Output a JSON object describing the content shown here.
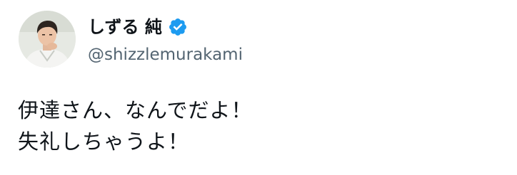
{
  "author": {
    "display_name": "しずる 純",
    "handle": "@shizzlemurakami",
    "verified_icon": "verified-badge-icon",
    "avatar_icon": "profile-photo"
  },
  "tweet": {
    "lines": [
      "伊達さん、なんでだよ！",
      "失礼しちゃうよ！"
    ]
  },
  "colors": {
    "text": "#0f1419",
    "handle": "#536471",
    "verified": "#1d9bf0"
  }
}
